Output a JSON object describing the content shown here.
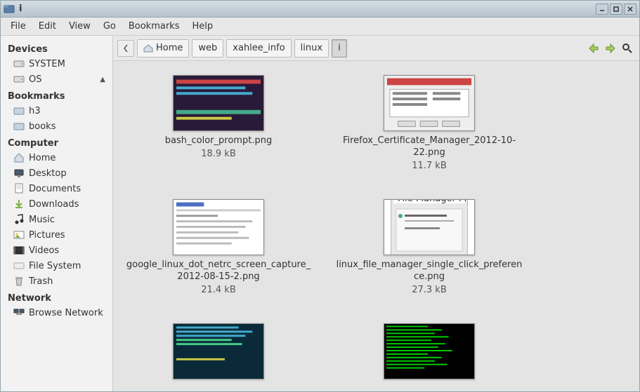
{
  "window": {
    "title": "i"
  },
  "menubar": [
    "File",
    "Edit",
    "View",
    "Go",
    "Bookmarks",
    "Help"
  ],
  "sidebar": {
    "sections": [
      {
        "title": "Devices",
        "items": [
          {
            "label": "SYSTEM",
            "icon": "drive"
          },
          {
            "label": "OS",
            "icon": "drive",
            "eject": true
          }
        ]
      },
      {
        "title": "Bookmarks",
        "items": [
          {
            "label": "h3",
            "icon": "folder"
          },
          {
            "label": "books",
            "icon": "folder"
          }
        ]
      },
      {
        "title": "Computer",
        "items": [
          {
            "label": "Home",
            "icon": "home"
          },
          {
            "label": "Desktop",
            "icon": "desktop"
          },
          {
            "label": "Documents",
            "icon": "documents"
          },
          {
            "label": "Downloads",
            "icon": "downloads"
          },
          {
            "label": "Music",
            "icon": "music"
          },
          {
            "label": "Pictures",
            "icon": "pictures"
          },
          {
            "label": "Videos",
            "icon": "videos"
          },
          {
            "label": "File System",
            "icon": "drive"
          },
          {
            "label": "Trash",
            "icon": "trash"
          }
        ]
      },
      {
        "title": "Network",
        "items": [
          {
            "label": "Browse Network",
            "icon": "network"
          }
        ]
      }
    ]
  },
  "pathbar": {
    "segments": [
      {
        "label": "Home",
        "icon": "home"
      },
      {
        "label": "web"
      },
      {
        "label": "xahlee_info"
      },
      {
        "label": "linux"
      },
      {
        "label": "i",
        "active": true
      }
    ]
  },
  "files": [
    {
      "name": "bash_color_prompt.png",
      "size": "18.9 kB",
      "thumb": "terminal"
    },
    {
      "name": "Firefox_Certificate_Manager_2012-10-22.png",
      "size": "11.7 kB",
      "thumb": "dialog"
    },
    {
      "name": "google_linux_dot_netrc_screen_capture_2012-08-15-2.png",
      "size": "21.4 kB",
      "thumb": "webpage"
    },
    {
      "name": "linux_file_manager_single_click_preference.png",
      "size": "27.3 kB",
      "thumb": "pref"
    },
    {
      "name": "",
      "size": "",
      "thumb": "terminal2"
    },
    {
      "name": "",
      "size": "",
      "thumb": "terminal3"
    }
  ]
}
